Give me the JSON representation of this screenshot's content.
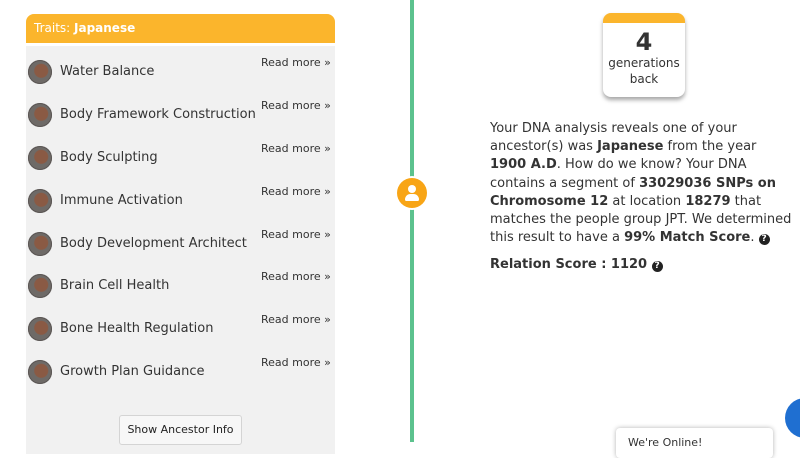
{
  "traits": {
    "header_prefix": "Traits: ",
    "header_group": "Japanese",
    "items": [
      {
        "label": "Water Balance",
        "more": "Read more »"
      },
      {
        "label": "Body Framework Construction",
        "more": "Read more »"
      },
      {
        "label": "Body Sculpting",
        "more": "Read more »"
      },
      {
        "label": "Immune Activation",
        "more": "Read more »"
      },
      {
        "label": "Body Development Architect",
        "more": "Read more »"
      },
      {
        "label": "Brain Cell Health",
        "more": "Read more »"
      },
      {
        "label": "Bone Health Regulation",
        "more": "Read more »"
      },
      {
        "label": "Growth Plan Guidance",
        "more": "Read more »"
      }
    ],
    "show_button": "Show Ancestor Info"
  },
  "generations": {
    "count": "4",
    "label_line1": "generations",
    "label_line2": "back"
  },
  "description": {
    "p1": "Your DNA analysis reveals one of your ancestor(s) was ",
    "group": "Japanese",
    "p2": " from the year ",
    "year": "1900 A.D",
    "p3": ". How do we know? Your DNA contains a segment of ",
    "snps": "33029036 SNPs on Chromosome 12",
    "p4": " at location ",
    "location": "18279",
    "p5": " that matches the people group JPT. We determined this result to have a ",
    "match": "99% Match Score",
    "p6": "."
  },
  "relation": {
    "label": "Relation Score : ",
    "value": "1120"
  },
  "chat": {
    "text": "We're Online!"
  },
  "colors": {
    "accent": "#fbb52c",
    "timeline": "#5cc28e",
    "node": "#f8a516",
    "panel": "#f1f1f1"
  },
  "icons": [
    "trait-avatar-icon",
    "person-icon",
    "question-icon",
    "chat-icon"
  ]
}
